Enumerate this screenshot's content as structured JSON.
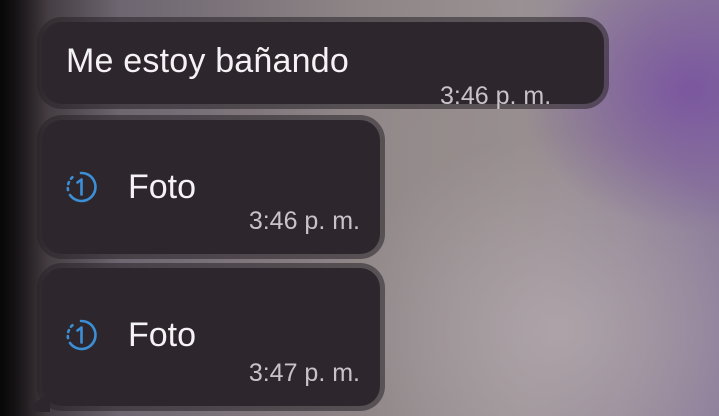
{
  "chat": {
    "messages": [
      {
        "type": "text",
        "text": "Me estoy bañando",
        "time": "3:46 p. m."
      },
      {
        "type": "view-once-photo",
        "icon": "view-once-icon",
        "label": "Foto",
        "time": "3:46 p. m."
      },
      {
        "type": "view-once-photo",
        "icon": "view-once-icon",
        "label": "Foto",
        "time": "3:47 p. m."
      }
    ]
  },
  "colors": {
    "bubble": "#2e262d",
    "text": "#f4f2f4",
    "timestamp": "#c9c3c8",
    "view_once_accent": "#3b8fd6"
  }
}
